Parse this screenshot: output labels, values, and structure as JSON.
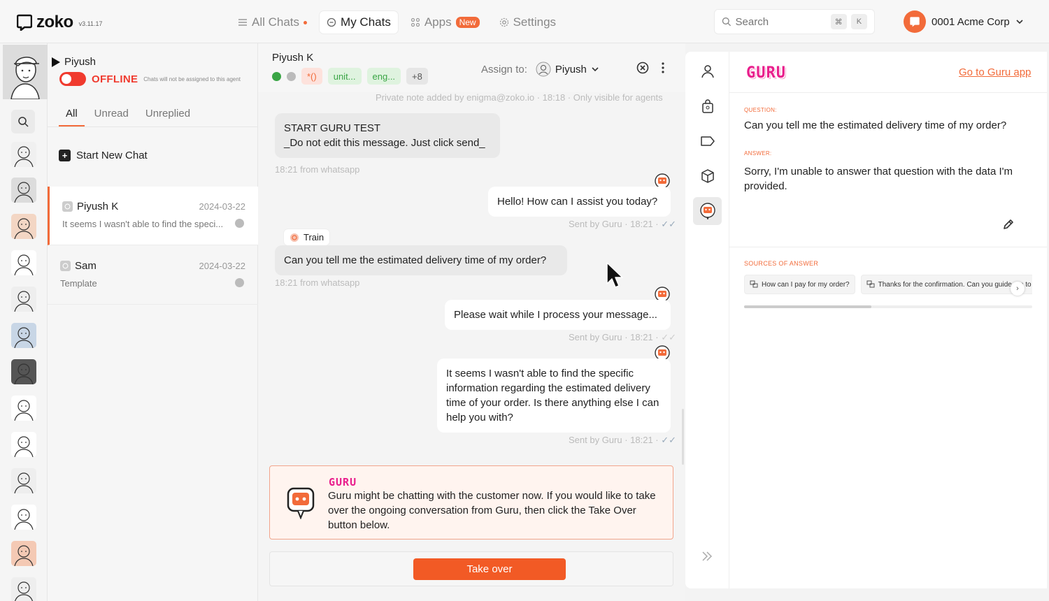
{
  "brand": {
    "name": "zoko",
    "version": "v3.11.17"
  },
  "nav": {
    "all_chats": "All Chats",
    "my_chats": "My Chats",
    "apps": "Apps",
    "apps_badge": "New",
    "settings": "Settings"
  },
  "search": {
    "placeholder": "Search",
    "kbd1": "⌘",
    "kbd2": "K"
  },
  "account": {
    "name": "0001 Acme Corp"
  },
  "agent": {
    "name": "Piyush",
    "status": "OFFLINE",
    "status_note": "Chats will not be assigned to this agent"
  },
  "filters": {
    "all": "All",
    "unread": "Unread",
    "unreplied": "Unreplied"
  },
  "start_new_chat": "Start New Chat",
  "chats": [
    {
      "name": "Piyush K",
      "date": "2024-03-22",
      "preview": "It seems I wasn't able to find the speci..."
    },
    {
      "name": "Sam",
      "date": "2024-03-22",
      "preview": "Template"
    }
  ],
  "conversation": {
    "contact": "Piyush K",
    "tags": {
      "t1": "*()",
      "t2": "unit...",
      "t3": "eng...",
      "more": "+8"
    },
    "assign_label": "Assign to:",
    "assignee": "Piyush",
    "note": "Private note added by enigma@zoko.io · 18:18 · Only visible for agents",
    "messages": {
      "m1_line1": "START GURU TEST",
      "m1_line2": "_Do not edit this message. Just click send_",
      "m1_meta": "18:21 from whatsapp",
      "m2": "Hello! How can I assist you today?",
      "m2_meta": "Sent by Guru · 18:21 ·",
      "train": "Train",
      "m3": "Can you tell me the estimated delivery time of my order?",
      "m3_meta": "18:21 from whatsapp",
      "m4": "Please wait while I process your message...",
      "m4_meta": "Sent by Guru · 18:21 ·",
      "m5": "It seems I wasn't able to find the specific information regarding the estimated delivery time of your order. Is there anything else I can help you with?",
      "m5_meta": "Sent by Guru · 18:21 ·"
    },
    "checkmark": "✓✓",
    "banner": {
      "brand": "GURU",
      "text": "Guru might be chatting with the customer now. If you would like to take over the ongoing conversation from Guru, then click the Take Over button below."
    },
    "take_over": "Take over"
  },
  "guru_panel": {
    "brand": "GURU",
    "link": "Go to Guru app",
    "question_label": "QUESTION:",
    "question": "Can you tell me the estimated delivery time of my order?",
    "answer_label": "ANSWER:",
    "answer": "Sorry, I'm unable to answer that question with the data I'm provided.",
    "sources_label": "SOURCES OF ANSWER",
    "sources": [
      "How can I pay for my order?",
      "Thanks for the confirmation. Can you guide me to"
    ],
    "next_arrow": "›"
  },
  "colors": {
    "accent": "#f26b3a",
    "guru_pink": "#e91e8c",
    "offline_red": "#f03a2e"
  }
}
